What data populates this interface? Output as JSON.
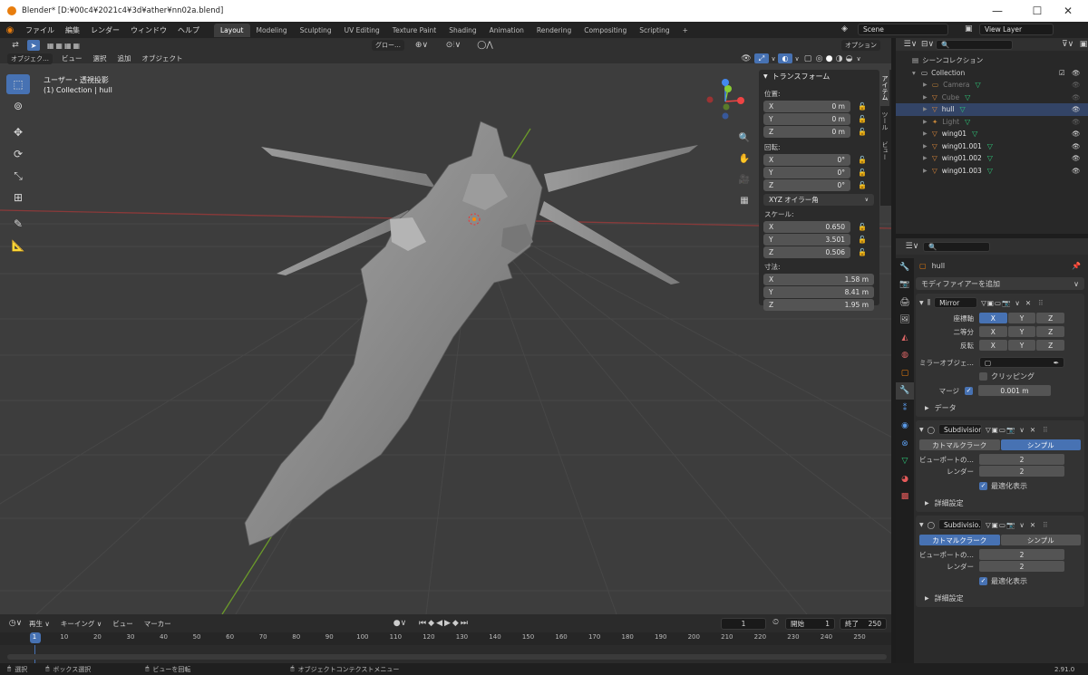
{
  "window": {
    "title": "Blender* [D:¥00c4¥2021c4¥3d¥ather¥nn02a.blend]",
    "minimize": "—",
    "maximize": "☐",
    "close": "✕"
  },
  "menu": [
    "ファイル",
    "編集",
    "レンダー",
    "ウィンドウ",
    "ヘルプ"
  ],
  "workspaces": [
    "Layout",
    "Modeling",
    "Sculpting",
    "UV Editing",
    "Texture Paint",
    "Shading",
    "Animation",
    "Rendering",
    "Compositing",
    "Scripting",
    "+"
  ],
  "scene": {
    "name": "Scene",
    "view_layer": "View Layer"
  },
  "viewport": {
    "mode": "オブジェク…",
    "menus": [
      "ビュー",
      "選択",
      "追加",
      "オブジェクト"
    ],
    "orientation": "グロー…",
    "options": "オプション",
    "overlay_title": "ユーザー・透視投影",
    "overlay_sub": "(1) Collection | hull"
  },
  "npanel": {
    "title": "トランスフォーム",
    "location_label": "位置:",
    "location": [
      {
        "axis": "X",
        "value": "0 m"
      },
      {
        "axis": "Y",
        "value": "0 m"
      },
      {
        "axis": "Z",
        "value": "0 m"
      }
    ],
    "rotation_label": "回転:",
    "rotation": [
      {
        "axis": "X",
        "value": "0°"
      },
      {
        "axis": "Y",
        "value": "0°"
      },
      {
        "axis": "Z",
        "value": "0°"
      }
    ],
    "rotation_mode": "XYZ オイラー角",
    "scale_label": "スケール:",
    "scale": [
      {
        "axis": "X",
        "value": "0.650"
      },
      {
        "axis": "Y",
        "value": "3.501"
      },
      {
        "axis": "Z",
        "value": "0.506"
      }
    ],
    "dimensions_label": "寸法:",
    "dimensions": [
      {
        "axis": "X",
        "value": "1.58 m"
      },
      {
        "axis": "Y",
        "value": "8.41 m"
      },
      {
        "axis": "Z",
        "value": "1.95 m"
      }
    ],
    "tabs": [
      "アイテム",
      "ツール",
      "ビュー"
    ]
  },
  "outliner": {
    "root": "シーンコレクション",
    "collection": "Collection",
    "items": [
      {
        "name": "Camera",
        "dim": true,
        "color": "#c7873a"
      },
      {
        "name": "Cube",
        "dim": true,
        "color": "#e08a3a"
      },
      {
        "name": "hull",
        "dim": false,
        "color": "#e08a3a"
      },
      {
        "name": "Light",
        "dim": true,
        "color": "#c7873a"
      },
      {
        "name": "wing01",
        "dim": false,
        "color": "#e08a3a"
      },
      {
        "name": "wing01.001",
        "dim": false,
        "color": "#e08a3a"
      },
      {
        "name": "wing01.002",
        "dim": false,
        "color": "#e08a3a"
      },
      {
        "name": "wing01.003",
        "dim": false,
        "color": "#e08a3a"
      }
    ]
  },
  "properties": {
    "object": "hull",
    "add_modifier": "モディファイアーを追加",
    "mirror": {
      "name": "Mirror",
      "axis_label": "座標軸",
      "bisect_label": "二等分",
      "flip_label": "反転",
      "axes": [
        "X",
        "Y",
        "Z"
      ],
      "mirror_object_label": "ミラーオブジェ…",
      "clipping_label": "クリッピング",
      "merge_label": "マージ",
      "merge_value": "0.001 m",
      "data_label": "データ"
    },
    "subdiv1": {
      "name": "Subdivision",
      "tabs": [
        "カトマルクラーク",
        "シンプル"
      ],
      "viewport_label": "ビューポートの…",
      "viewport_value": "2",
      "render_label": "レンダー",
      "render_value": "2",
      "optimal_label": "最適化表示",
      "advanced_label": "詳細設定"
    },
    "subdiv2": {
      "name": "Subdivisio…",
      "tabs": [
        "カトマルクラーク",
        "シンプル"
      ],
      "viewport_label": "ビューポートの…",
      "viewport_value": "2",
      "render_label": "レンダー",
      "render_value": "2",
      "optimal_label": "最適化表示",
      "advanced_label": "詳細設定"
    }
  },
  "timeline": {
    "menus": [
      "再生",
      "キーイング",
      "ビュー",
      "マーカー"
    ],
    "current_frame": "1",
    "start_label": "開始",
    "start": "1",
    "end_label": "終了",
    "end": "250",
    "ticks": [
      "1",
      "10",
      "20",
      "30",
      "40",
      "50",
      "60",
      "70",
      "80",
      "90",
      "100",
      "110",
      "120",
      "130",
      "140",
      "150",
      "160",
      "170",
      "180",
      "190",
      "200",
      "210",
      "220",
      "230",
      "240",
      "250"
    ]
  },
  "status": {
    "select": "選択",
    "box": "ボックス選択",
    "rotate": "ビューを回転",
    "context": "オブジェクトコンテクストメニュー",
    "version": "2.91.0"
  }
}
